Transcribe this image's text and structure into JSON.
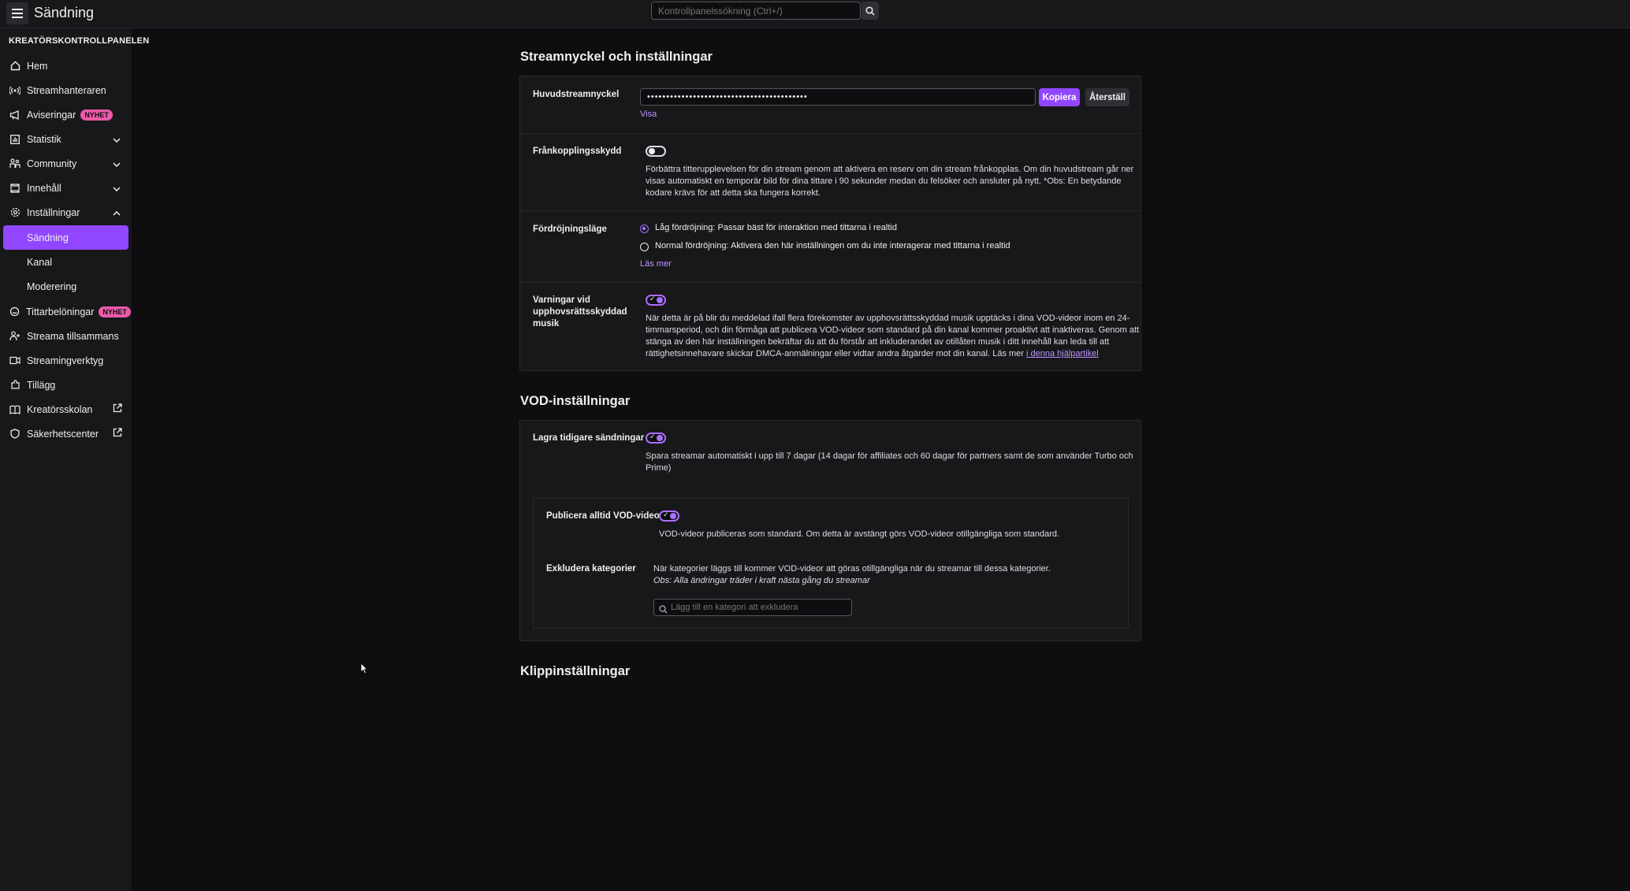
{
  "topbar": {
    "title": "Sändning",
    "search_placeholder": "Kontrollpanelssökning (Ctrl+/)"
  },
  "sidebar": {
    "heading": "KREATÖRSKONTROLLPANELEN",
    "items": [
      {
        "label": "Hem",
        "icon": "home-icon"
      },
      {
        "label": "Streamhanteraren",
        "icon": "broadcast-icon"
      },
      {
        "label": "Aviseringar",
        "icon": "megaphone-icon",
        "badge": "NYHET"
      },
      {
        "label": "Statistik",
        "icon": "chart-icon"
      },
      {
        "label": "Community",
        "icon": "community-icon"
      },
      {
        "label": "Innehåll",
        "icon": "content-icon"
      },
      {
        "label": "Inställningar",
        "icon": "gear-icon"
      },
      {
        "label": "Sändning"
      },
      {
        "label": "Kanal"
      },
      {
        "label": "Moderering"
      },
      {
        "label": "Tittarbelöningar",
        "icon": "reward-icon",
        "badge": "NYHET"
      },
      {
        "label": "Streama tillsammans",
        "icon": "add-user-icon"
      },
      {
        "label": "Streamingverktyg",
        "icon": "camera-icon"
      },
      {
        "label": "Tillägg",
        "icon": "puzzle-icon"
      },
      {
        "label": "Kreatörsskolan",
        "icon": "book-icon"
      },
      {
        "label": "Säkerhetscenter",
        "icon": "shield-icon"
      }
    ]
  },
  "stream_section": {
    "title": "Streamnyckel och inställningar",
    "key_label": "Huvudstreamnyckel",
    "key_value": "••••••••••••••••••••••••••••••••••••••••••",
    "copy_label": "Kopiera",
    "reset_label": "Återställ",
    "show_label": "Visa",
    "disconnect_label": "Frånkopplingsskydd",
    "disconnect_desc_1": "Förbättra titterupplevelsen för din stream genom att aktivera en reserv om din stream frånkopplas. Om din huvudstream går ner",
    "disconnect_desc_2": "visas automatiskt en temporär bild för dina tittare i 90 sekunder medan du felsöker och ansluter på nytt. *Obs: En betydande",
    "disconnect_desc_3": "kodare krävs för att detta ska fungera korrekt.",
    "latency_label": "Fördröjningsläge",
    "latency_low": "Låg fördröjning: Passar bäst för interaktion med tittarna i realtid",
    "latency_normal": "Normal fördröjning: Aktivera den här inställningen om du inte interagerar med tittarna i realtid",
    "read_more": "Läs mer",
    "music_label_1": "Varningar vid",
    "music_label_2": "upphovsrättsskyddad",
    "music_label_3": "musik",
    "music_desc_1": "När detta är på blir du meddelad ifall flera förekomster av upphovsrättsskyddad musik upptäcks i dina VOD-videor inom en 24-",
    "music_desc_2": "timmarsperiod, och din förmåga att publicera VOD-videor som standard på din kanal kommer proaktivt att inaktiveras. Genom att",
    "music_desc_3": "stänga av den här inställningen bekräftar du att du förstår att inkluderandet av otillåten musik i ditt innehåll kan leda till att",
    "music_desc_4": "rättighetsinnehavare skickar DMCA-anmälningar eller vidtar andra åtgärder mot din kanal. Läs mer",
    "music_link": "i denna hjälpartikel"
  },
  "vod_section": {
    "title": "VOD-inställningar",
    "store_label": "Lagra tidigare sändningar",
    "store_desc_1": "Spara streamar automatiskt i upp till 7 dagar (14 dagar för affiliates och 60 dagar för partners samt de som använder Turbo och",
    "store_desc_2": "Prime)",
    "publish_label": "Publicera alltid VOD-videor",
    "publish_desc": "VOD-videor publiceras som standard. Om detta är avstängt görs VOD-videor otillgängliga som standard.",
    "exclude_label": "Exkludera kategorier",
    "exclude_desc": "När kategorier läggs till kommer VOD-videor att göras otillgängliga när du streamar till dessa kategorier.",
    "exclude_note": "Obs: Alla ändringar träder i kraft nästa gång du streamar",
    "exclude_placeholder": "Lägg till en kategori att exkludera"
  },
  "clip_section": {
    "title": "Klippinställningar"
  },
  "colors": {
    "accent": "#9147ff",
    "badge": "#eb5aa8",
    "link": "#bf94ff"
  }
}
